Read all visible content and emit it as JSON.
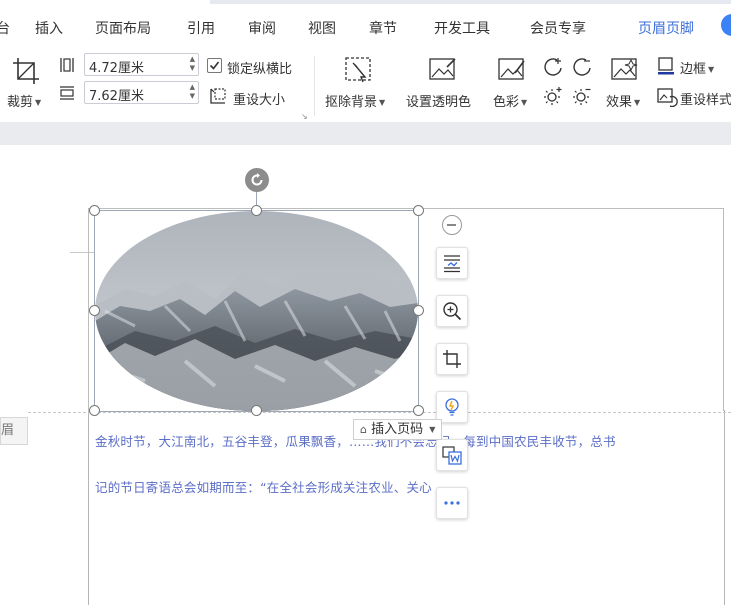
{
  "menu": {
    "items": [
      {
        "label": "台"
      },
      {
        "label": "插入"
      },
      {
        "label": "页面布局"
      },
      {
        "label": "引用"
      },
      {
        "label": "审阅"
      },
      {
        "label": "视图"
      },
      {
        "label": "章节"
      },
      {
        "label": "开发工具"
      },
      {
        "label": "会员专享"
      },
      {
        "label": "页眉页脚",
        "active": true
      }
    ]
  },
  "toolbar": {
    "crop_label": "裁剪",
    "width_value": "4.72厘米",
    "height_value": "7.62厘米",
    "lock_ratio_label": "锁定纵横比",
    "lock_ratio_checked": true,
    "reset_size_label": "重设大小",
    "remove_bg_label": "抠除背景",
    "set_transparent_label": "设置透明色",
    "color_label": "色彩",
    "effects_label": "效果",
    "border_label": "边框",
    "reset_style_label": "重设样式"
  },
  "document": {
    "line1": "金秋时节，大江南北，五谷丰登，瓜果飘香，……我们不会忘记，每到中国农民丰收节，总书",
    "line2": "记的节日寄语总会如期而至：“在全社会形成关注农业、关心",
    "insert_page_number_label": "插入页码",
    "header_tag_label": "眉"
  },
  "colors": {
    "accent": "#3b6fdc",
    "body_text": "#5b6ec7",
    "canvas_bg": "#e9ebee"
  }
}
